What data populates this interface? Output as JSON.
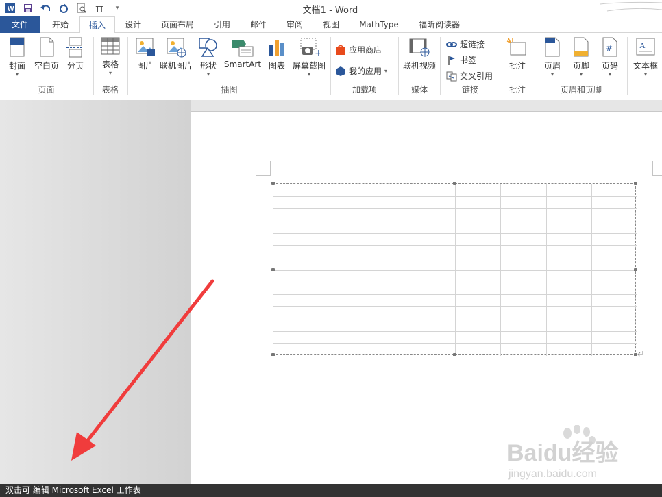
{
  "window": {
    "title": "文档1 - Word"
  },
  "quick_access": [
    {
      "name": "word-logo-icon",
      "glyph": "W"
    },
    {
      "name": "save-icon",
      "glyph": "▣"
    },
    {
      "name": "undo-icon",
      "glyph": "↶"
    },
    {
      "name": "repeat-icon",
      "glyph": "↻"
    },
    {
      "name": "print-preview-icon",
      "glyph": "⌕"
    },
    {
      "name": "pi-icon",
      "glyph": "π"
    },
    {
      "name": "customize-qat-icon",
      "glyph": "▾"
    }
  ],
  "tabs": [
    {
      "label": "文件"
    },
    {
      "label": "开始"
    },
    {
      "label": "插入"
    },
    {
      "label": "设计"
    },
    {
      "label": "页面布局"
    },
    {
      "label": "引用"
    },
    {
      "label": "邮件"
    },
    {
      "label": "审阅"
    },
    {
      "label": "视图"
    },
    {
      "label": "MathType"
    },
    {
      "label": "福昕阅读器"
    }
  ],
  "active_tab": "插入",
  "ribbon": {
    "pages": {
      "label": "页面",
      "buttons": [
        "封面",
        "空白页",
        "分页"
      ]
    },
    "tables": {
      "label": "表格",
      "buttons": [
        "表格"
      ]
    },
    "illustrations": {
      "label": "插图",
      "buttons": [
        "图片",
        "联机图片",
        "形状",
        "SmartArt",
        "图表",
        "屏幕截图"
      ]
    },
    "addins": {
      "label": "加载项",
      "buttons": [
        "应用商店",
        "我的应用"
      ]
    },
    "media": {
      "label": "媒体",
      "buttons": [
        "联机视频"
      ]
    },
    "links": {
      "label": "链接",
      "buttons": [
        "超链接",
        "书签",
        "交叉引用"
      ]
    },
    "comments": {
      "label": "批注",
      "buttons": [
        "批注"
      ]
    },
    "header_footer": {
      "label": "页眉和页脚",
      "buttons": [
        "页眉",
        "页脚",
        "页码"
      ]
    },
    "text": {
      "buttons": [
        "文本框"
      ]
    }
  },
  "document": {
    "embedded_table": {
      "columns": 8,
      "rows": 14
    }
  },
  "status": {
    "text": "双击可 编辑 Microsoft Excel 工作表"
  },
  "watermark": {
    "brand": "Baidu经验",
    "url": "jingyan.baidu.com"
  },
  "colors": {
    "word_blue": "#2b579a",
    "arrow_red": "#f03c3c",
    "status_bg": "#333333"
  }
}
